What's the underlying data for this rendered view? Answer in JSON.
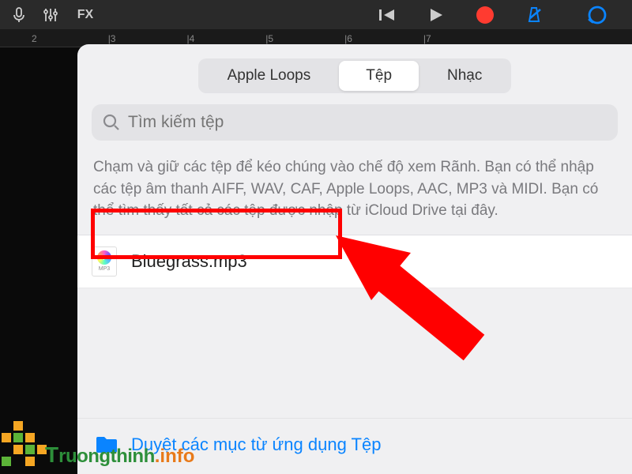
{
  "ruler": {
    "marks": [
      "2",
      "|3",
      "|4",
      "|5",
      "|6",
      "|7"
    ]
  },
  "toolbar": {
    "fx_label": "FX"
  },
  "popover": {
    "tabs": [
      {
        "label": "Apple Loops",
        "active": false
      },
      {
        "label": "Tệp",
        "active": true
      },
      {
        "label": "Nhạc",
        "active": false
      }
    ],
    "search_placeholder": "Tìm kiếm tệp",
    "help_text": "Chạm và giữ các tệp để kéo chúng vào chế độ xem Rãnh. Bạn có thể nhập các tệp âm thanh AIFF, WAV, CAF, Apple Loops, AAC, MP3 và MIDI. Bạn có thể tìm thấy tất cả các tệp được nhập từ iCloud Drive tại đây.",
    "file": {
      "name": "Bluegrass.mp3",
      "type_label": "MP3"
    },
    "browse_label": "Duyệt các mục từ ứng dụng Tệp"
  },
  "watermark": {
    "brand_t": "T",
    "brand_rest": "ruongthinh",
    "brand_suffix": ".info"
  }
}
